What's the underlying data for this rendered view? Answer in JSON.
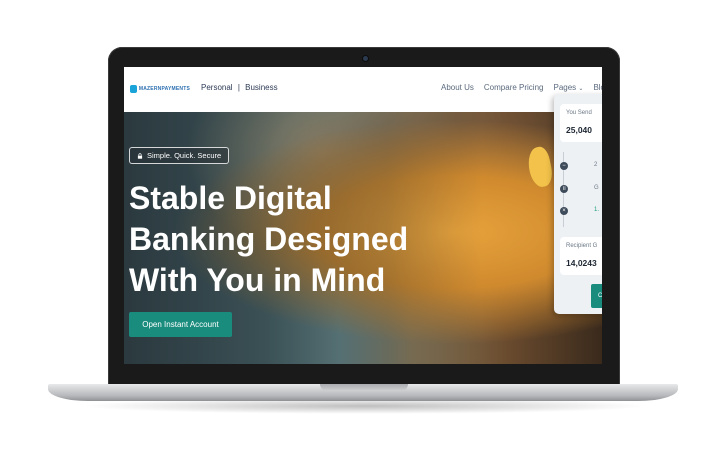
{
  "navbar": {
    "logo_text": "MAZERNPAYMENTS",
    "segment_personal": "Personal",
    "segment_separator": "|",
    "segment_business": "Business",
    "links": [
      "About Us",
      "Compare Pricing",
      "Pages",
      "Blo"
    ]
  },
  "hero": {
    "badge": "Simple. Quick. Secure",
    "title_lines": [
      "Stable Digital",
      "Banking Designed",
      "With You in Mind"
    ],
    "cta_label": "Open Instant Account"
  },
  "converter": {
    "send_label": "You Send",
    "send_value": "25,040",
    "steps": [
      {
        "icon": "minus-icon",
        "symbol": "−",
        "text": "2"
      },
      {
        "icon": "pause-icon",
        "symbol": "॥",
        "text": "G"
      },
      {
        "icon": "close-icon",
        "symbol": "×",
        "text": "1."
      }
    ],
    "recipient_label": "Recipient G",
    "recipient_value": "14,0243",
    "button_label": "C"
  },
  "colors": {
    "accent": "#1a8c7e",
    "nav_text": "#2d3b55",
    "highlight_yellow": "#f2c24a"
  }
}
